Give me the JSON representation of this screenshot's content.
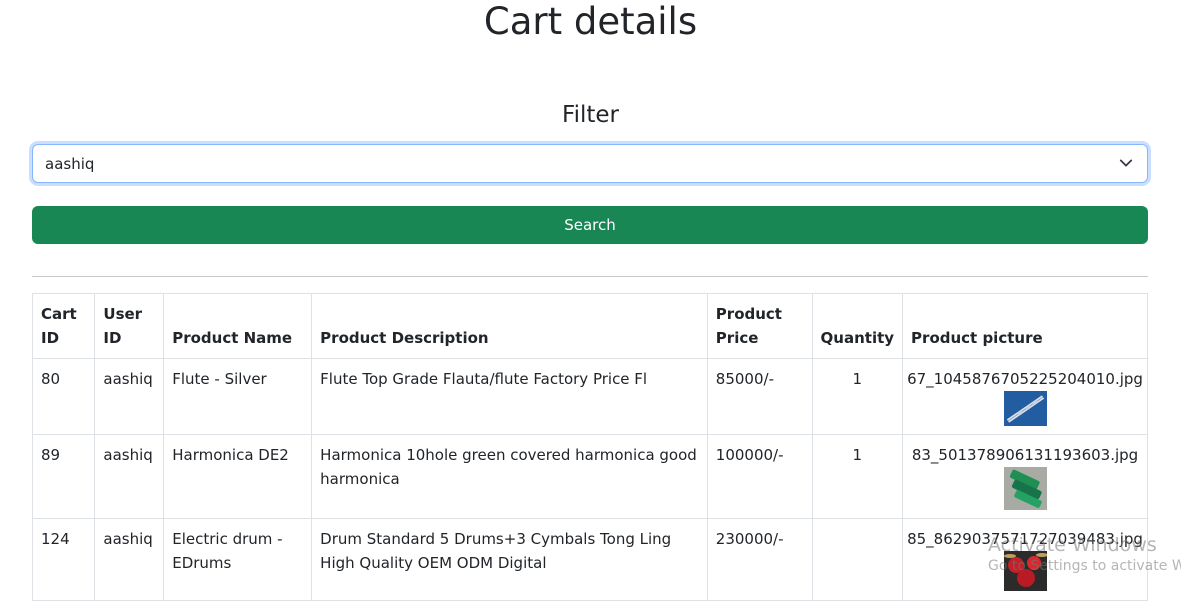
{
  "page": {
    "title": "Cart details",
    "filter_heading": "Filter"
  },
  "filter": {
    "selected_user": "aashiq",
    "search_label": "Search"
  },
  "table": {
    "headers": {
      "cart_id": "Cart ID",
      "user_id": "User ID",
      "product_name": "Product Name",
      "product_description": "Product Description",
      "product_price": "Product Price",
      "quantity": "Quantity",
      "product_picture": "Product picture"
    },
    "rows": [
      {
        "cart_id": "80",
        "user_id": "aashiq",
        "product_name": "Flute - Silver",
        "product_description": "Flute Top Grade Flauta/flute Factory Price Fl",
        "product_price": "85000/-",
        "quantity": "1",
        "picture_file": "67_1045876705225204010.jpg",
        "picture_icon": "flute-thumbnail"
      },
      {
        "cart_id": "89",
        "user_id": "aashiq",
        "product_name": "Harmonica DE2",
        "product_description": "Harmonica 10hole green covered harmonica good harmonica",
        "product_price": "100000/-",
        "quantity": "1",
        "picture_file": "83_501378906131193603.jpg",
        "picture_icon": "harmonica-thumbnail"
      },
      {
        "cart_id": "124",
        "user_id": "aashiq",
        "product_name": "Electric drum - EDrums",
        "product_description": "Drum Standard 5 Drums+3 Cymbals Tong Ling High Quality OEM ODM Digital",
        "product_price": "230000/-",
        "quantity": "",
        "picture_file": "85_8629037571727039483.jpg",
        "picture_icon": "drum-thumbnail"
      }
    ]
  },
  "watermark": {
    "line1": "Activate Windows",
    "line2": "Go to Settings to activate Windows."
  },
  "colors": {
    "search_button": "#198754",
    "focus_ring": "#86b7fe"
  }
}
